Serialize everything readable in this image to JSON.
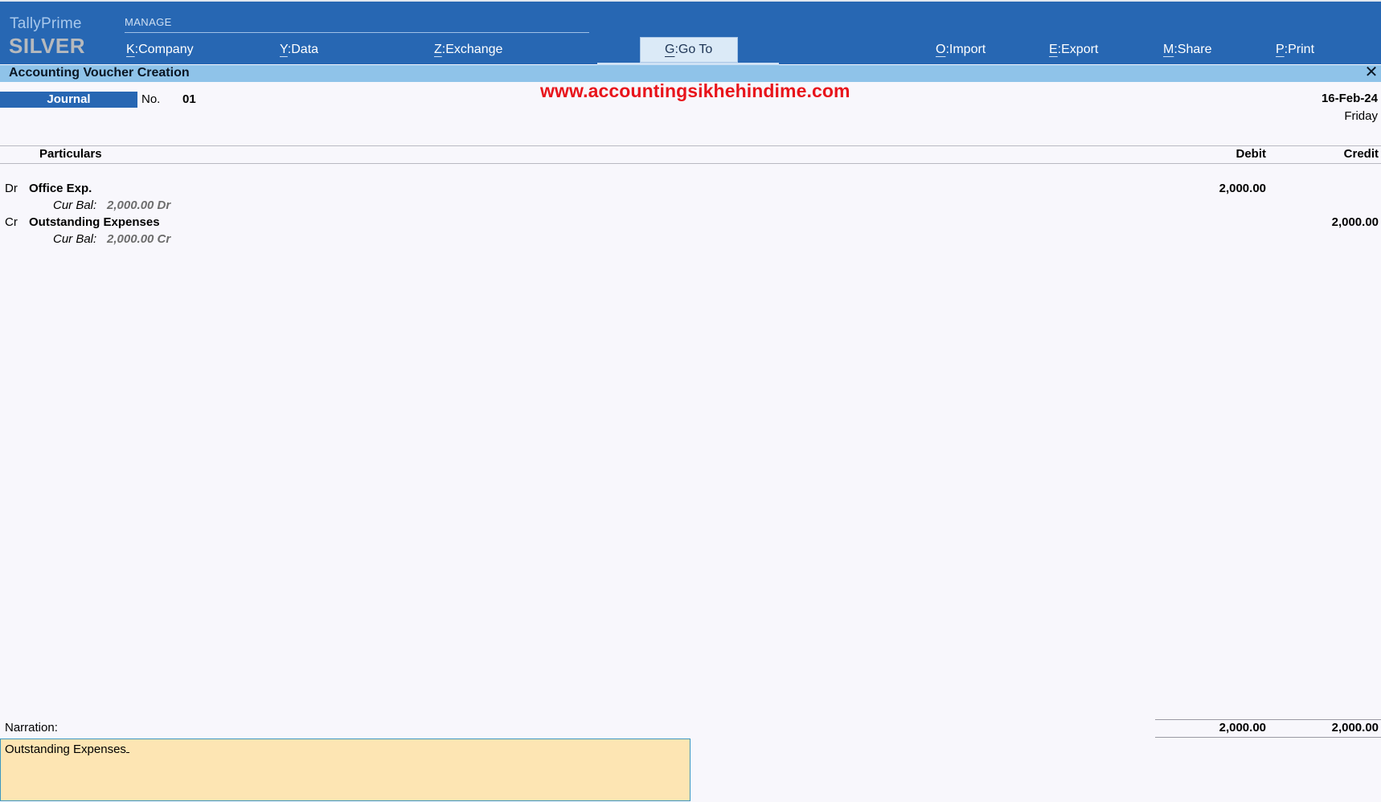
{
  "app": {
    "brand_name": "TallyPrime",
    "brand_edition": "SILVER",
    "manage_label": "MANAGE"
  },
  "menu": [
    {
      "key": "K",
      "label": "Company"
    },
    {
      "key": "Y",
      "label": "Data"
    },
    {
      "key": "Z",
      "label": "Exchange"
    },
    {
      "key": "G",
      "label": "Go To"
    },
    {
      "key": "O",
      "label": "Import"
    },
    {
      "key": "E",
      "label": "Export"
    },
    {
      "key": "M",
      "label": "Share"
    },
    {
      "key": "P",
      "label": "Print"
    }
  ],
  "window": {
    "title": "Accounting Voucher Creation",
    "close_symbol": "✕"
  },
  "voucher": {
    "type": "Journal",
    "no_label": "No.",
    "no_value": "01",
    "date": "16-Feb-24",
    "day": "Friday"
  },
  "watermark": "www.accountingsikhehindime.com",
  "columns": {
    "particulars": "Particulars",
    "debit": "Debit",
    "credit": "Credit"
  },
  "entries": [
    {
      "type": "Dr",
      "ledger": "Office Exp.",
      "cur_bal_label": "Cur Bal:",
      "cur_bal_value": "2,000.00 Dr",
      "debit": "2,000.00",
      "credit": ""
    },
    {
      "type": "Cr",
      "ledger": "Outstanding Expenses",
      "cur_bal_label": "Cur Bal:",
      "cur_bal_value": "2,000.00 Cr",
      "debit": "",
      "credit": "2,000.00"
    }
  ],
  "narration": {
    "label": "Narration:",
    "value": "Outstanding Expenses"
  },
  "totals": {
    "debit": "2,000.00",
    "credit": "2,000.00"
  },
  "colors": {
    "topbar": "#2767b3",
    "titlebar": "#8fc3e9",
    "watermark": "#e8141b",
    "narration_bg": "#fde5b3"
  }
}
